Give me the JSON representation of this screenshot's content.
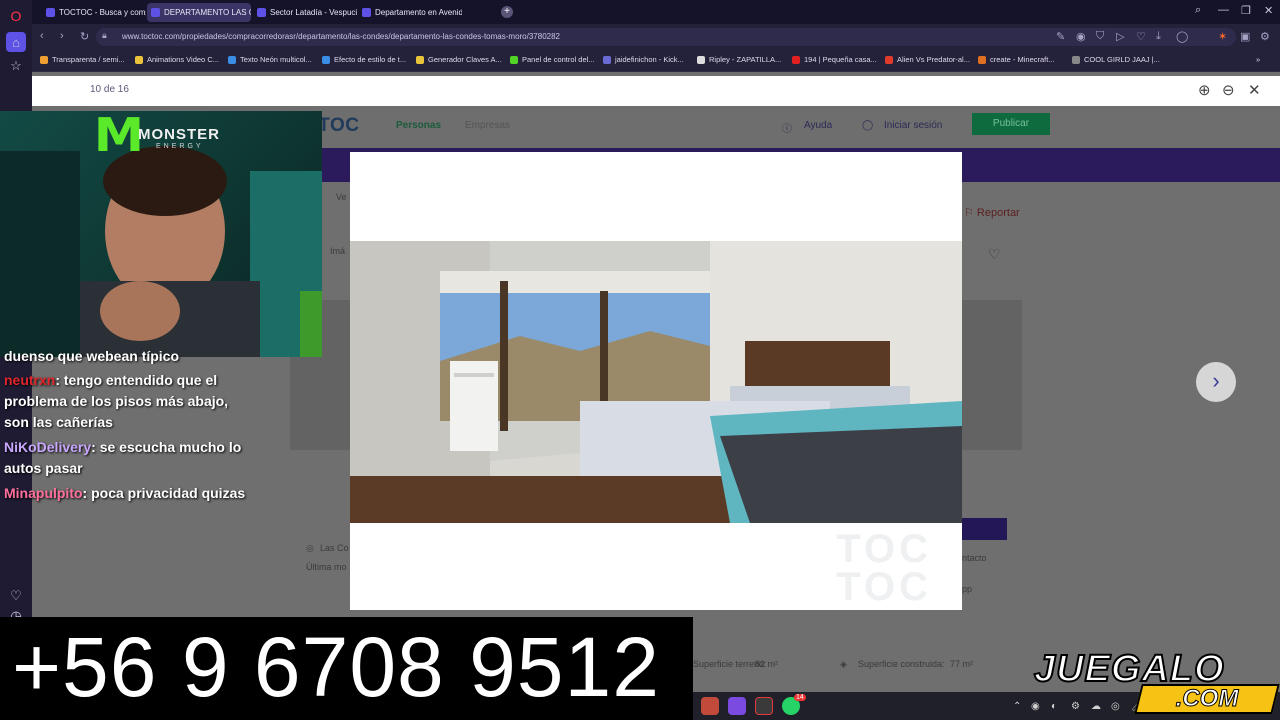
{
  "browser": {
    "tabs": [
      {
        "label": "TOCTOC - Busca y compr",
        "active": false
      },
      {
        "label": "DEPARTAMENTO LAS CO",
        "active": true
      },
      {
        "label": "Sector Latadía - Vespucio",
        "active": false
      },
      {
        "label": "Departamento en Avenid",
        "active": false
      }
    ],
    "new_tab": "+",
    "url": "www.toctoc.com/propiedades/compracorredorasr/departamento/las-condes/departamento-las-condes-tomas-moro/3780282",
    "bookmarks": [
      {
        "label": "Transparenta / semi...",
        "color": "#f0a030"
      },
      {
        "label": "Animations Video C...",
        "color": "#e9c33a"
      },
      {
        "label": "Texto Neón multicol...",
        "color": "#3a8ee6"
      },
      {
        "label": "Efecto de estilo de t...",
        "color": "#3a8ee6"
      },
      {
        "label": "Generador Claves A...",
        "color": "#e9c33a"
      },
      {
        "label": "Panel de control del...",
        "color": "#53d326"
      },
      {
        "label": "jaidefinichon - Kick...",
        "color": "#6b6bd6"
      },
      {
        "label": "Ripley - ZAPATILLA...",
        "color": "#dddddd"
      },
      {
        "label": "194 | Pequeña casa...",
        "color": "#e02020"
      },
      {
        "label": "Alien Vs Predator-al...",
        "color": "#e03a2a"
      },
      {
        "label": "create - Minecraft...",
        "color": "#e07020"
      },
      {
        "label": "COOL GIRLD JAAJ |...",
        "color": "#888888"
      }
    ]
  },
  "viewer": {
    "counter": "10 de 16",
    "zoom_in_icon": "zoom-in-icon",
    "zoom_out_icon": "zoom-out-icon",
    "close_icon": "close-icon",
    "next_icon": "chevron-right-icon"
  },
  "site": {
    "logo": "TOCTOC",
    "nav": [
      "Personas",
      "Empresas"
    ],
    "help": "Ayuda",
    "login": "Iniciar sesión",
    "publish": "Publicar",
    "report": "Reportar",
    "breadcrumb_fragment": "Ve",
    "images_fragment": "Imá",
    "location_fragment": "Las Co",
    "updated_fragment": "Última mo",
    "contact_fragment": "ntacto",
    "app_fragment": "pp",
    "land_area_label": "Superficie terreno:",
    "land_area": "82 m²",
    "built_area_label": "Superficie construida:",
    "built_area": "77 m²"
  },
  "modal": {
    "watermark_top": "TOC",
    "watermark_bottom": "TOC"
  },
  "stream": {
    "sponsor_word": "MONSTER",
    "sponsor_sub": "ENERGY",
    "chat": [
      {
        "user": "",
        "text": "duenso que webean típico",
        "color": "#ffffff"
      },
      {
        "user": "neutrxn",
        "text": ": tengo entendido que el problema de los pisos más abajo, son las cañerías",
        "color": "#e0262a"
      },
      {
        "user": "NiKoDelivery",
        "text": ": se escucha mucho lo autos pasar",
        "color": "#c9a6ff"
      },
      {
        "user": "Minapulpito",
        "text": ": poca privacidad quizas",
        "color": "#ff6f9b"
      }
    ],
    "phone": "+56 9 6708 9512",
    "brand_top": "JUEGALO",
    "brand_bottom": ".COM"
  },
  "taskbar": {
    "whatsapp_badge": "14"
  }
}
